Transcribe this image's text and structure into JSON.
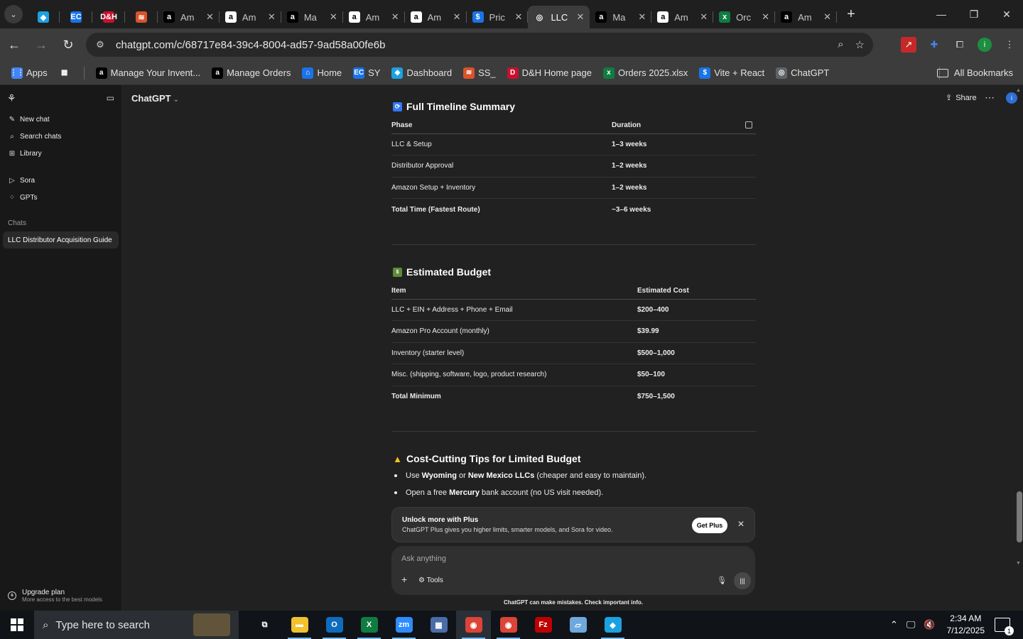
{
  "browser": {
    "tabs": [
      {
        "title": "",
        "fav_text": "◆",
        "fav_color": "#1ba1e2",
        "pinned": true
      },
      {
        "title": "",
        "fav_text": "EC",
        "fav_color": "#1a73e8",
        "pinned": true
      },
      {
        "title": "",
        "fav_text": "D&H",
        "fav_color": "#c8102e",
        "pinned": true
      },
      {
        "title": "",
        "fav_text": "≋",
        "fav_color": "#d9532c",
        "pinned": true
      },
      {
        "title": "Am",
        "fav_text": "a",
        "fav_color": "#000000",
        "pinned": false
      },
      {
        "title": "Am",
        "fav_text": "a",
        "fav_color": "#ffffff",
        "pinned": false
      },
      {
        "title": "Ma",
        "fav_text": "a",
        "fav_color": "#000000",
        "pinned": false
      },
      {
        "title": "Am",
        "fav_text": "a",
        "fav_color": "#ffffff",
        "pinned": false
      },
      {
        "title": "Am",
        "fav_text": "a",
        "fav_color": "#ffffff",
        "pinned": false
      },
      {
        "title": "Pric",
        "fav_text": "$",
        "fav_color": "#1a73e8",
        "pinned": false
      },
      {
        "title": "LLC",
        "fav_text": "◎",
        "fav_color": "#3c3c3c",
        "pinned": false,
        "active": true
      },
      {
        "title": "Ma",
        "fav_text": "a",
        "fav_color": "#000000",
        "pinned": false
      },
      {
        "title": "Am",
        "fav_text": "a",
        "fav_color": "#ffffff",
        "pinned": false
      },
      {
        "title": "Orc",
        "fav_text": "x",
        "fav_color": "#107c41",
        "pinned": false
      },
      {
        "title": "Am",
        "fav_text": "a",
        "fav_color": "#000000",
        "pinned": false
      }
    ],
    "url": "chatgpt.com/c/68717e84-39c4-8004-ad57-9ad58a00fe6b",
    "bookmarks": [
      {
        "label": "Apps",
        "icon": "⋮⋮",
        "color": "#4285f4"
      },
      {
        "label": "",
        "icon": "▦",
        "color": "#3c3c3c"
      },
      {
        "label": "Manage Your Invent...",
        "icon": "a",
        "color": "#000000"
      },
      {
        "label": "Manage Orders",
        "icon": "a",
        "color": "#000000"
      },
      {
        "label": "Home",
        "icon": "⌂",
        "color": "#1a73e8"
      },
      {
        "label": "SY",
        "icon": "EC",
        "color": "#1a73e8"
      },
      {
        "label": "Dashboard",
        "icon": "◆",
        "color": "#1ba1e2"
      },
      {
        "label": "SS_",
        "icon": "≋",
        "color": "#d9532c"
      },
      {
        "label": "D&H Home page",
        "icon": "D",
        "color": "#c8102e"
      },
      {
        "label": "Orders 2025.xlsx",
        "icon": "x",
        "color": "#107c41"
      },
      {
        "label": "Vite + React",
        "icon": "$",
        "color": "#1a73e8"
      },
      {
        "label": "ChatGPT",
        "icon": "◎",
        "color": "#5f6368"
      }
    ],
    "all_bookmarks": "All Bookmarks"
  },
  "sidebar": {
    "nav": [
      {
        "label": "New chat",
        "icon": "✎"
      },
      {
        "label": "Search chats",
        "icon": "⌕"
      },
      {
        "label": "Library",
        "icon": "⊞"
      }
    ],
    "nav2": [
      {
        "label": "Sora",
        "icon": "▷"
      },
      {
        "label": "GPTs",
        "icon": "⁘"
      }
    ],
    "chats_label": "Chats",
    "active_chat": "LLC Distributor Acquisition Guide",
    "upgrade_title": "Upgrade plan",
    "upgrade_sub": "More access to the best models"
  },
  "header": {
    "model": "ChatGPT",
    "share": "Share"
  },
  "timeline": {
    "title": "Full Timeline Summary",
    "headers": [
      "Phase",
      "Duration"
    ],
    "rows": [
      [
        "LLC & Setup",
        "1–3 weeks"
      ],
      [
        "Distributor Approval",
        "1–2 weeks"
      ],
      [
        "Amazon Setup + Inventory",
        "1–2 weeks"
      ],
      [
        "Total Time (Fastest Route)",
        "~3–6 weeks"
      ]
    ]
  },
  "budget": {
    "title": "Estimated Budget",
    "headers": [
      "Item",
      "Estimated Cost"
    ],
    "rows": [
      [
        "LLC + EIN + Address + Phone + Email",
        "$200–400"
      ],
      [
        "Amazon Pro Account (monthly)",
        "$39.99"
      ],
      [
        "Inventory (starter level)",
        "$500–1,000"
      ],
      [
        "Misc. (shipping, software, logo, product research)",
        "$50–100"
      ],
      [
        "Total Minimum",
        "$750–1,500"
      ]
    ]
  },
  "tips": {
    "title": "Cost-Cutting Tips for Limited Budget",
    "items": [
      {
        "pre": "Use ",
        "b1": "Wyoming",
        "mid": " or ",
        "b2": "New Mexico LLCs",
        "post": " (cheaper and easy to maintain)."
      },
      {
        "pre": "Open a free ",
        "b1": "Mercury",
        "mid": " bank account (no US visit needed).",
        "b2": "",
        "post": ""
      }
    ]
  },
  "upsell": {
    "title": "Unlock more with Plus",
    "subtitle": "ChatGPT Plus gives you higher limits, smarter models, and Sora for video.",
    "button": "Get Plus"
  },
  "composer": {
    "placeholder": "Ask anything",
    "tools": "Tools"
  },
  "disclaimer": "ChatGPT can make mistakes. Check important info.",
  "taskbar": {
    "search_placeholder": "Type here to search",
    "apps": [
      {
        "name": "task-view",
        "text": "⧉",
        "color": "#101418",
        "on": false
      },
      {
        "name": "file-explorer",
        "text": "▬",
        "color": "#f2c12e",
        "on": true
      },
      {
        "name": "outlook",
        "text": "O",
        "color": "#0f6cbd",
        "on": true
      },
      {
        "name": "excel",
        "text": "X",
        "color": "#107c41",
        "on": true
      },
      {
        "name": "zoom",
        "text": "zm",
        "color": "#2d8cff",
        "on": true
      },
      {
        "name": "calculator",
        "text": "▦",
        "color": "#4a6da7",
        "on": false
      },
      {
        "name": "chrome",
        "text": "◉",
        "color": "#db4437",
        "on": true,
        "hl": true
      },
      {
        "name": "chrome-profile",
        "text": "◉",
        "color": "#db4437",
        "on": true
      },
      {
        "name": "filezilla",
        "text": "Fz",
        "color": "#bf0000",
        "on": false
      },
      {
        "name": "notes",
        "text": "▱",
        "color": "#6fa8dc",
        "on": false
      },
      {
        "name": "app-diamond",
        "text": "◆",
        "color": "#1ba1e2",
        "on": true
      }
    ],
    "time": "2:34 AM",
    "date": "7/12/2025",
    "notifications": "1"
  }
}
